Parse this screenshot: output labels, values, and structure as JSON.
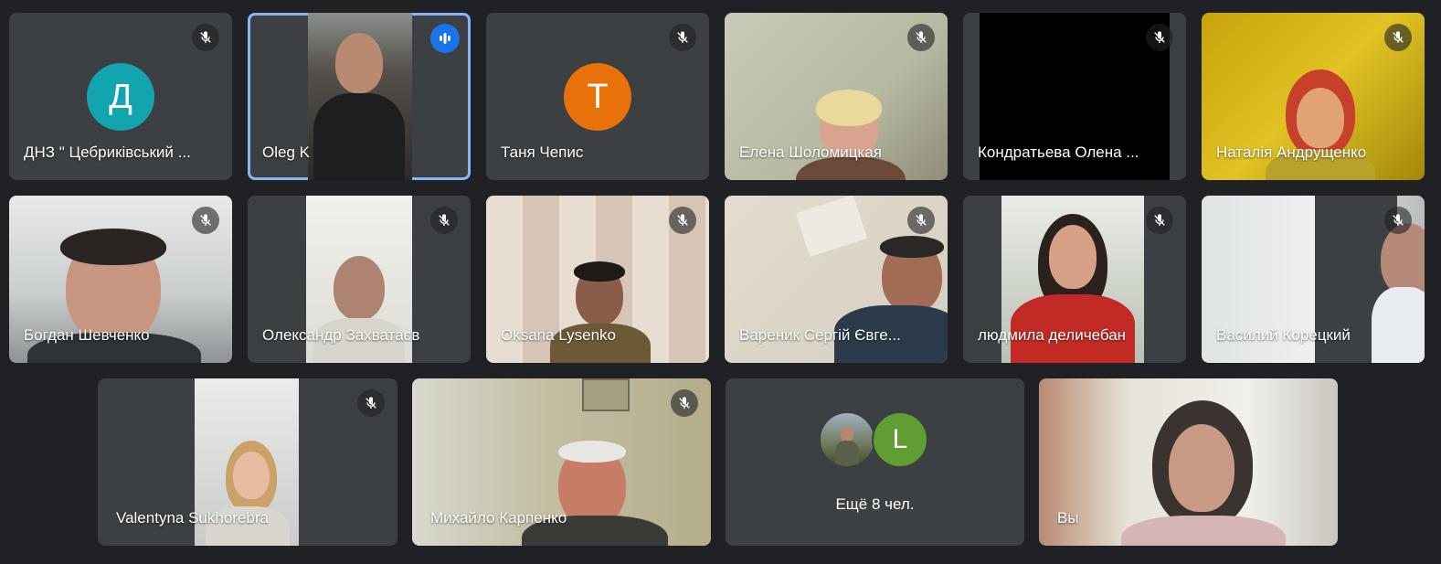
{
  "participants": [
    {
      "name": "ДНЗ \" Цебриківський ...",
      "avatar_letter": "Д",
      "avatar_color": "#12a4af",
      "muted": true
    },
    {
      "name": "Oleg K",
      "muted": false,
      "speaking": true
    },
    {
      "name": "Таня Чепис",
      "avatar_letter": "Т",
      "avatar_color": "#e8710a",
      "muted": true
    },
    {
      "name": "Елена Шоломицкая",
      "muted": true
    },
    {
      "name": "Кондратьева Олена ...",
      "muted": true
    },
    {
      "name": "Наталія Андрущенко",
      "muted": true
    },
    {
      "name": "Богдан Шевченко",
      "muted": true
    },
    {
      "name": "Олександр Захватаєв",
      "muted": true
    },
    {
      "name": "Oksana Lysenko",
      "muted": true
    },
    {
      "name": "Вареник Сергій Євге...",
      "muted": true
    },
    {
      "name": "людмила деличебан",
      "muted": true
    },
    {
      "name": "Василий Корецкий",
      "muted": true
    },
    {
      "name": "Valentyna Sukhorebra",
      "muted": true
    },
    {
      "name": "Михайло Карпенко",
      "muted": true
    },
    {
      "name": "Вы",
      "muted": false
    }
  ],
  "more_tile": {
    "label": "Ещё 8 чел.",
    "avatar_letter": "L",
    "avatar_color": "#5e9e32"
  },
  "icons": {
    "muted": "mic-off-icon",
    "speaking": "audio-level-icon"
  },
  "colors": {
    "background": "#202124",
    "tile": "#3c4043",
    "speaking_border": "#8ab4f8",
    "speaking_badge": "#1a73e8"
  }
}
